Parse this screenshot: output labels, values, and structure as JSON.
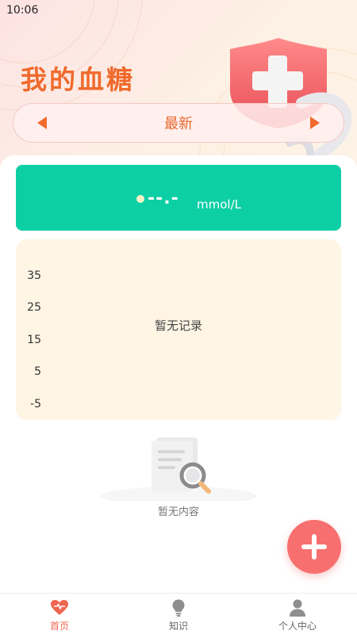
{
  "status_bar": {
    "time": "10:06"
  },
  "header": {
    "title": "我的血糖",
    "date_selector": {
      "label": "最新",
      "prev_icon": "caret-left-icon",
      "next_icon": "caret-right-icon"
    },
    "decoration_icon": "medical-cross-shield-icon"
  },
  "reading": {
    "value": "--.-",
    "unit": "mmol/L"
  },
  "chart": {
    "y_ticks": [
      "35",
      "25",
      "15",
      "5",
      "-5"
    ],
    "empty_text": "暂无记录"
  },
  "chart_data": {
    "type": "line",
    "title": "",
    "xlabel": "",
    "ylabel": "",
    "ylim": [
      -5,
      35
    ],
    "y_ticks": [
      35,
      25,
      15,
      5,
      -5
    ],
    "series": [],
    "empty_text": "暂无记录"
  },
  "empty_state": {
    "icon": "document-search-icon",
    "text": "暂无内容"
  },
  "fab": {
    "icon": "plus-icon"
  },
  "colors": {
    "accent": "#f06a2c",
    "reading_card": "#0ccfa6",
    "chart_bg": "#fff5e5",
    "fab": "#f76f6f",
    "tab_active": "#f06a50"
  },
  "tabs": [
    {
      "label": "首页",
      "icon": "heart-icon",
      "active": true
    },
    {
      "label": "知识",
      "icon": "lightbulb-icon",
      "active": false
    },
    {
      "label": "个人中心",
      "icon": "person-icon",
      "active": false
    }
  ]
}
